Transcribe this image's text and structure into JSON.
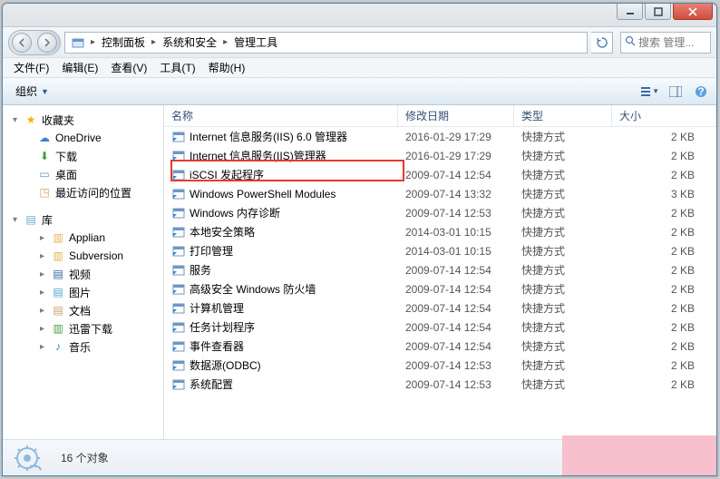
{
  "breadcrumb": {
    "icon": "▸",
    "seg0": "控制面板",
    "seg1": "系统和安全",
    "seg2": "管理工具"
  },
  "search": {
    "placeholder": "搜索 管理..."
  },
  "menu": {
    "file": "文件(F)",
    "edit": "编辑(E)",
    "view": "查看(V)",
    "tools": "工具(T)",
    "help": "帮助(H)"
  },
  "cmd": {
    "organize": "组织"
  },
  "columns": {
    "name": "名称",
    "date": "修改日期",
    "type": "类型",
    "size": "大小"
  },
  "nav": {
    "favorites": "收藏夹",
    "onedrive": "OneDrive",
    "downloads": "下载",
    "desktop": "桌面",
    "recent": "最近访问的位置",
    "libraries": "库",
    "applian": "Applian",
    "subversion": "Subversion",
    "videos": "视频",
    "pictures": "图片",
    "documents": "文档",
    "thunder": "迅雷下载",
    "music": "音乐"
  },
  "items": [
    {
      "name": "Internet 信息服务(IIS) 6.0 管理器",
      "date": "2016-01-29 17:29",
      "type": "快捷方式",
      "size": "2 KB"
    },
    {
      "name": "Internet 信息服务(IIS)管理器",
      "date": "2016-01-29 17:29",
      "type": "快捷方式",
      "size": "2 KB"
    },
    {
      "name": "iSCSI 发起程序",
      "date": "2009-07-14 12:54",
      "type": "快捷方式",
      "size": "2 KB"
    },
    {
      "name": "Windows PowerShell Modules",
      "date": "2009-07-14 13:32",
      "type": "快捷方式",
      "size": "3 KB"
    },
    {
      "name": "Windows 内存诊断",
      "date": "2009-07-14 12:53",
      "type": "快捷方式",
      "size": "2 KB"
    },
    {
      "name": "本地安全策略",
      "date": "2014-03-01 10:15",
      "type": "快捷方式",
      "size": "2 KB"
    },
    {
      "name": "打印管理",
      "date": "2014-03-01 10:15",
      "type": "快捷方式",
      "size": "2 KB"
    },
    {
      "name": "服务",
      "date": "2009-07-14 12:54",
      "type": "快捷方式",
      "size": "2 KB"
    },
    {
      "name": "高级安全 Windows 防火墙",
      "date": "2009-07-14 12:54",
      "type": "快捷方式",
      "size": "2 KB"
    },
    {
      "name": "计算机管理",
      "date": "2009-07-14 12:54",
      "type": "快捷方式",
      "size": "2 KB"
    },
    {
      "name": "任务计划程序",
      "date": "2009-07-14 12:54",
      "type": "快捷方式",
      "size": "2 KB"
    },
    {
      "name": "事件查看器",
      "date": "2009-07-14 12:54",
      "type": "快捷方式",
      "size": "2 KB"
    },
    {
      "name": "数据源(ODBC)",
      "date": "2009-07-14 12:53",
      "type": "快捷方式",
      "size": "2 KB"
    },
    {
      "name": "系统配置",
      "date": "2009-07-14 12:53",
      "type": "快捷方式",
      "size": "2 KB"
    }
  ],
  "status": {
    "count": "16 个对象"
  }
}
